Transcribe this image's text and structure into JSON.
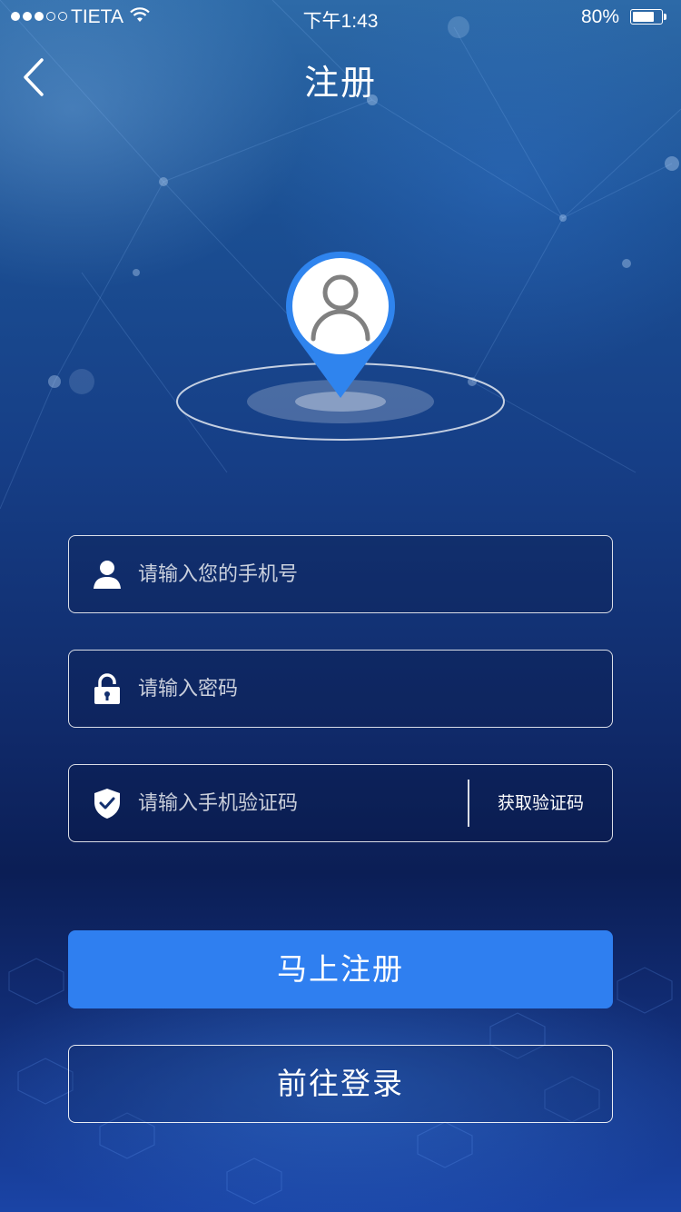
{
  "status_bar": {
    "carrier": "TIETA",
    "time": "下午1:43",
    "battery_percent": "80%",
    "battery_level": 0.8,
    "signal_bars_filled": 3,
    "signal_bars_total": 5
  },
  "nav": {
    "title": "注册",
    "back_icon": "chevron-left-icon"
  },
  "form": {
    "phone": {
      "placeholder": "请输入您的手机号",
      "value": "",
      "icon": "user-icon"
    },
    "password": {
      "placeholder": "请输入密码",
      "value": "",
      "icon": "lock-icon"
    },
    "code": {
      "placeholder": "请输入手机验证码",
      "value": "",
      "icon": "shield-check-icon",
      "get_code_label": "获取验证码"
    }
  },
  "actions": {
    "register_label": "马上注册",
    "login_label": "前往登录"
  },
  "colors": {
    "primary_button": "#2f7ff0",
    "pin": "#2f84ee",
    "text": "#ffffff"
  }
}
